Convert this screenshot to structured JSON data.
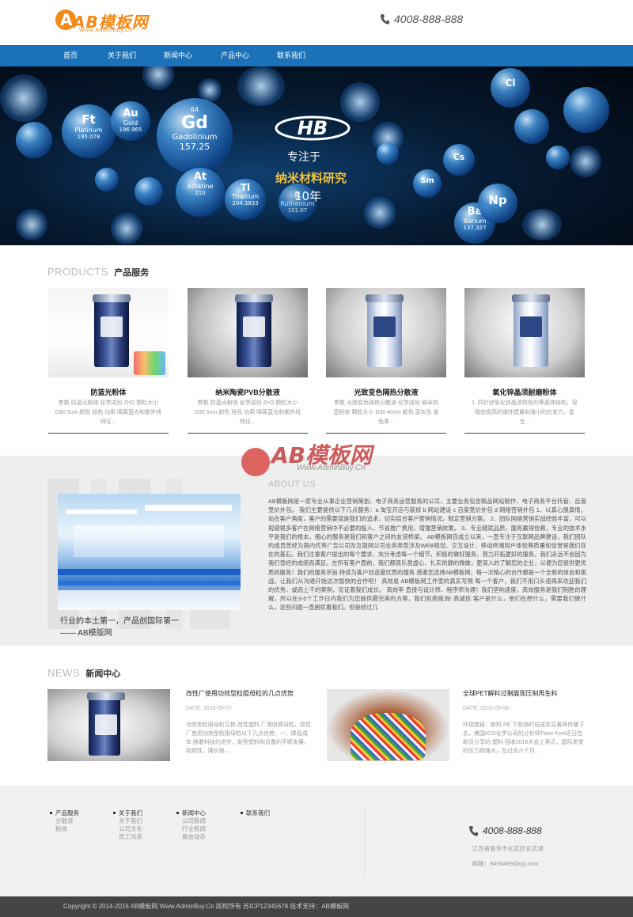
{
  "header": {
    "logo_text": "AB模板网",
    "logo_sub": "Www.AdminBuy.Cn",
    "phone": "4008-888-888"
  },
  "nav": {
    "items": [
      {
        "label": "首页"
      },
      {
        "label": "关于我们"
      },
      {
        "label": "新闻中心"
      },
      {
        "label": "产品中心"
      },
      {
        "label": "联系我们"
      }
    ]
  },
  "banner": {
    "brand": "HB",
    "line1": "专注于",
    "line2": "纳米材料研究",
    "line3": "10年",
    "elements": [
      {
        "num": "",
        "sym": "Ft",
        "name": "Platinum",
        "mass": "195.078"
      },
      {
        "num": "",
        "sym": "Au",
        "name": "Gold",
        "mass": "196.965"
      },
      {
        "num": "64",
        "sym": "Gd",
        "name": "Gadolinium",
        "mass": "157.25"
      },
      {
        "num": "",
        "sym": "At",
        "name": "Astatine",
        "mass": "210"
      },
      {
        "num": "",
        "sym": "Tl",
        "name": "Thallium",
        "mass": "204.3833"
      },
      {
        "num": "",
        "sym": "R",
        "name": "Ruthenium",
        "mass": "101.07"
      },
      {
        "num": "",
        "sym": "Ba",
        "name": "Barium",
        "mass": "137.327"
      },
      {
        "num": "",
        "sym": "Np",
        "name": "",
        "mass": ""
      },
      {
        "num": "",
        "sym": "Cs",
        "name": "",
        "mass": ""
      },
      {
        "num": "",
        "sym": "Sm",
        "name": "",
        "mass": ""
      },
      {
        "num": "",
        "sym": "Cl",
        "name": "",
        "mass": ""
      }
    ]
  },
  "products": {
    "title_en": "PRODUCTS",
    "title_cn": "产品服务",
    "items": [
      {
        "name": "防蓝光粉体",
        "desc": "参数 防蓝光粉体 化学成份 ZnO 颗粒大小 D90 5um 颜色 轻色 功用 隔离蓝光和紫外线 特征..."
      },
      {
        "name": "纳米陶瓷PVB分散液",
        "desc": "参数 防蓝光粉体 化学成份 ZnO 颗粒大小 D90 5um 颜色 轻色 功用 隔离蓝光和紫外线 特征..."
      },
      {
        "name": "光致变色隔热分散液",
        "desc": "参数 光致变色隔热分散液 化学成份 纳米钨蓝粉体 颗粒大小 D50 40nm 颜色 蓝灰色 变色率..."
      },
      {
        "name": "氧化锌晶须耐磨粉体",
        "desc": "1. 四针状氧化锌晶须特有的等晶体结构，容阻由极高的弹性模量和强小的应变力。复合..."
      }
    ]
  },
  "about": {
    "title_en": "ABOUT US",
    "caption1": "行业的本土第一，产品创国际第一",
    "caption2": "——  AB模版网",
    "text": "AB模板网是一家专业从事企业营销策划、电子商务运营服务的公司，主要业务包含精品网站制作、电子商务平台托管、百度竞价外包。 我们主要提供以下几点服务：a 淘宝开店与装修 b 网站建设 c 百度竞价外包 d 网络营销外包 1、以真心换真情，站在客户角度，客户的需要就是我们的追求，切实结合客户营销情况，制定营销方案。 2、团队网络营销实战经验丰富，可以规避很多客户在网络营销中不必要的投入，节省推广费用，增强营销效果。 3、专业踏就品质，服务赢得信赖，专业的技术水平是我们的根本，细心的服务是我们和客户之间的友谊桥梁。 AB模板网自成立以来，一直专注于互联网品牌建设，我们团队的成员曾经为国内优秀广告公司及互联网公司业务类型涉及WEB视觉、交互设计、移动终端用户体验等质量和信誉是我们存在的基石。我们注重客户提出的每个要求，充分考虑每一个细节，积极的做好服务，努力开拓更好的服务。我们永远不会因为我们曾经的成绩而满足。在所有客户面前，我们都很乐意虚心、扎实的静的微做，更深入的了解您的企业，以便为您提供更优质的服务！我们的服务宗旨:持续为客户创造最优质的服务 感谢您选择AB模板网，每一次精心的合作都是一个全新的体会和挑战，让我们从沟通开始这次愉快的合作吧！ 高效是 AB模板网工作室的真实写照 每一个客户，我们不用口头语再来欢迎我们的优秀，或而上千的案例，见证着我们成长。 高效率 直接与设计师、程序师沟通！我们坚响速度，高效服务是我们制胜的理解，所以在3-5个工作日内我们为您提供最完美的方案，我们拒绝拖询! 高诚信 客户是什么，他们在想什么，需要我们做什么，这些问题一直困扰着我们。但是经过几"
  },
  "watermark": {
    "text": "AB模板网",
    "sub": "Www.AdminBuy.Cn"
  },
  "news": {
    "title_en": "NEWS",
    "title_cn": "新闻中心",
    "items": [
      {
        "title": "改性厂使用功效型粒阻母粒的几点优势",
        "date": "DATE: 2016-09-07",
        "desc": "功效型粒阻母粒又称 改性塑料 厂用阻燃母粒，改性厂使用功效型粒阻母粒以下几点优势：一、降低成本 随着科技的进步，新型塑料和设备的不断发展，阻燃性，降价格..."
      },
      {
        "title": "全球PET解料过剩展现压制再生料",
        "date": "DATE: 2016-09-06",
        "desc": "环球塑报：新料 PE 下跌随时低成本显著将传播下去，美国ICIS化学公司的分析师Tison Keel近日在新员分享的 塑料 回收2016大会上表示，国际承受的压力越强大，在过去六个月..."
      }
    ]
  },
  "footer": {
    "columns": [
      {
        "heading": "产品服务",
        "items": [
          "分散液",
          "粉体"
        ]
      },
      {
        "heading": "关于我们",
        "items": [
          "关于我们",
          "公司文化",
          "员工风采"
        ]
      },
      {
        "heading": "新闻中心",
        "items": [
          "公司新闻",
          "行业新闻",
          "展会动态"
        ]
      },
      {
        "heading": "联系我们",
        "items": []
      }
    ],
    "phone": "4008-888-888",
    "address": "· 江苏省南京市玄武区玄武湖",
    "email": "· 邮箱：9490489@qq.com",
    "copyright": "Copyright © 2014-2016 AB模板网 Www.AdminBuy.Cn 版权所有 苏ICP12345678 技术支持：AB模板网"
  }
}
